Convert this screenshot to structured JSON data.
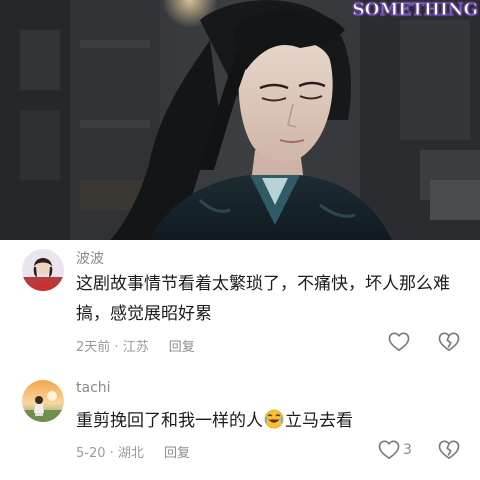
{
  "watermark": "SOMETHING",
  "comments": [
    {
      "username": "波波",
      "text": "这剧故事情节看着太繁琐了，不痛快，坏人那么难搞，感觉展昭好累",
      "time": "2天前",
      "location": "江苏",
      "reply_label": "回复",
      "like_count": ""
    },
    {
      "username": "tachi",
      "text_before_emoji": "重剪挽回了和我一样的人",
      "emoji": "crying-laughing-emoji",
      "text_after_emoji": "立马去看",
      "time": "5-20",
      "location": "湖北",
      "reply_label": "回复",
      "like_count": "3"
    }
  ],
  "icons": {
    "like": "heart-icon",
    "dislike": "broken-heart-icon"
  }
}
